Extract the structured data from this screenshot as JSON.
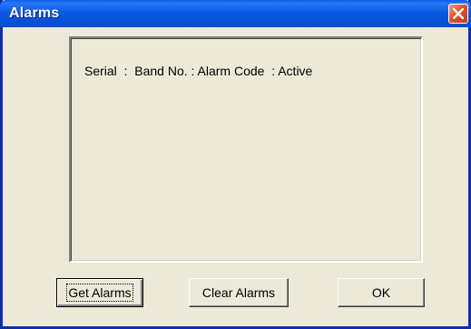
{
  "window": {
    "title": "Alarms",
    "close_icon": "close-icon"
  },
  "alarm_list": {
    "header": "Serial  :  Band No. : Alarm Code  : Active",
    "items": []
  },
  "buttons": {
    "get_alarms": "Get Alarms",
    "clear_alarms": "Clear Alarms",
    "ok": "OK"
  },
  "colors": {
    "titlebar": "#0a5ae6",
    "window_bg": "#ece9d8",
    "close_button": "#e2532a"
  }
}
